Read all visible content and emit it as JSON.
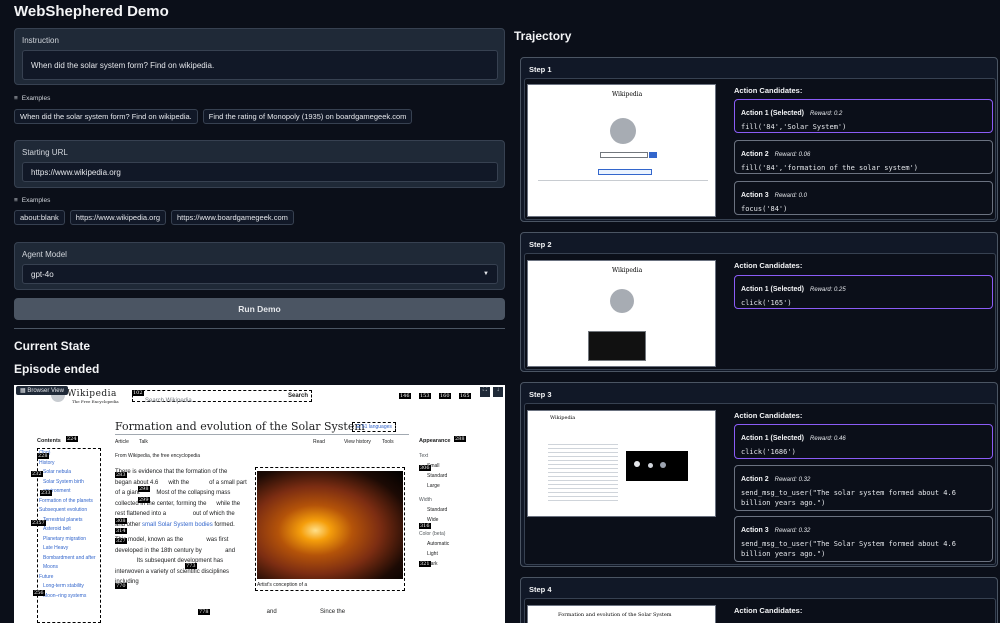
{
  "app_title": "WebShephered Demo",
  "instruction": {
    "label": "Instruction",
    "value": "When did the solar system form? Find on wikipedia.",
    "examples_label": "Examples",
    "examples": [
      "When did the solar system form? Find on wikipedia.",
      "Find the rating of Monopoly (1935) on boardgamegeek.com"
    ]
  },
  "starting_url": {
    "label": "Starting URL",
    "value": "https://www.wikipedia.org",
    "examples_label": "Examples",
    "examples": [
      "about:blank",
      "https://www.wikipedia.org",
      "https://www.boardgamegeek.com"
    ]
  },
  "agent_model": {
    "label": "Agent Model",
    "value": "gpt-4o"
  },
  "run_button": "Run Demo",
  "current_state": "Current State",
  "episode_status": "Episode ended",
  "browser_view": {
    "label": "Browser View",
    "wiki": {
      "logo": "Wikipedia",
      "logo_sub": "The Free Encyclopedia",
      "search_placeholder": "Search Wikipedia",
      "search_btn": "Search",
      "article_title": "Formation and evolution of the Solar System",
      "languages": "51 languages",
      "tab_article": "Article",
      "tab_talk": "Talk",
      "tab_read": "Read",
      "tab_view_history": "View history",
      "tab_tools": "Tools",
      "from": "From Wikipedia, the free encyclopedia",
      "contents": "Contents",
      "toc": [
        "(Top)",
        "History",
        "Solar nebula",
        "Solar System birth environment",
        "Formation of the planets",
        "Subsequent evolution",
        "Terrestrial planets",
        "Asteroid belt",
        "Planetary migration",
        "Late Heavy Bombardment and after",
        "Moons",
        "Future",
        "Long-term stability",
        "Moon–ring systems"
      ],
      "para1_a": "There is evidence that the formation of the",
      "para1_b": "began about 4.6",
      "para1_c": "with the",
      "para1_d": "of a small part of",
      "para1_e": "a giant",
      "para1_f": "Most of the",
      "para1_g": "collapsing mass collected in the center, forming",
      "para1_h": "the",
      "para1_i": "while the rest flattened into a",
      "para1_j": "out of which the",
      "para1_k": "and other",
      "para1_l": "small Solar",
      "para1_m": "System bodies",
      "para1_n": "formed.",
      "para2_a": "This model, known as the",
      "para2_b": "was first developed in the 18th century by",
      "para2_c": "and",
      "para2_d": "Its subsequent",
      "para2_e": "development has interwoven a variety of",
      "para2_f": "scientific disciplines including",
      "para2_g": "and",
      "para2_h": "Since the",
      "caption": "Artist's conception of a",
      "appearance": "Appearance",
      "text_label": "Text",
      "text_opts": [
        "Small",
        "Standard",
        "Large"
      ],
      "width_label": "Width",
      "width_opts": [
        "Standard",
        "Wide"
      ],
      "color_label": "Color (beta)",
      "color_opts": [
        "Automatic",
        "Light",
        "Dark"
      ]
    }
  },
  "trajectory": {
    "title": "Trajectory",
    "candidates_label": "Action Candidates:",
    "steps": [
      {
        "title": "Step 1",
        "candidates": [
          {
            "title": "Action 1 (Selected)",
            "reward": "Reward: 0.2",
            "code": "fill('84','Solar System')",
            "selected": true
          },
          {
            "title": "Action 2",
            "reward": "Reward: 0.06",
            "code": "fill('84','formation of the solar system')",
            "selected": false
          },
          {
            "title": "Action 3",
            "reward": "Reward: 0.0",
            "code": "focus('84')",
            "selected": false
          }
        ]
      },
      {
        "title": "Step 2",
        "candidates": [
          {
            "title": "Action 1 (Selected)",
            "reward": "Reward: 0.25",
            "code": "click('165')",
            "selected": true
          }
        ]
      },
      {
        "title": "Step 3",
        "candidates": [
          {
            "title": "Action 1 (Selected)",
            "reward": "Reward: 0.46",
            "code": "click('1686')",
            "selected": true
          },
          {
            "title": "Action 2",
            "reward": "Reward: 0.32",
            "code": "send_msg_to_user(\"The solar system formed about 4.6 billion years ago.\")",
            "selected": false
          },
          {
            "title": "Action 3",
            "reward": "Reward: 0.32",
            "code": "send_msg_to_user(\"The Solar System formed about 4.6 billion years ago.\")",
            "selected": false
          }
        ]
      },
      {
        "title": "Step 4",
        "candidates": []
      }
    ]
  },
  "colors": {
    "background": "#0b0f19",
    "panel": "#1f2937",
    "selected_border": "#8b5cf6"
  }
}
